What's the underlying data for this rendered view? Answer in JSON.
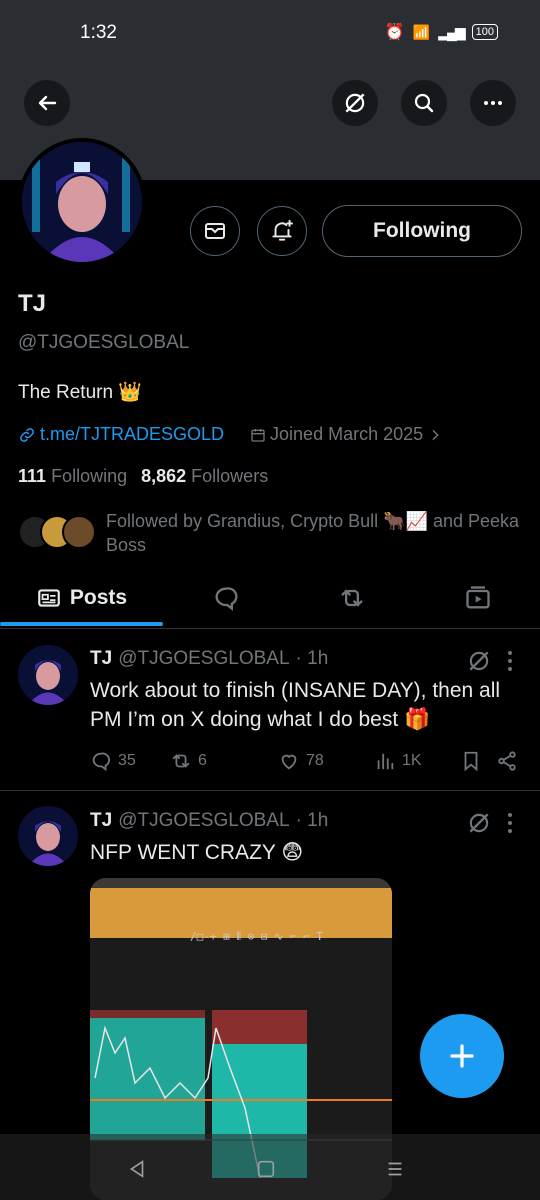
{
  "status_bar": {
    "time": "1:32",
    "battery": "100"
  },
  "profile": {
    "name": "TJ",
    "handle": "@TJGOESGLOBAL",
    "bio": "The Return 👑",
    "link": "t.me/TJTRADESGOLD",
    "joined": "Joined March 2025",
    "following_count": "111",
    "following_label": "Following",
    "followers_count": "8,862",
    "followers_label": "Followers",
    "followed_by": "Followed by Grandius, Crypto Bull 🐂📈 and Peeka Boss",
    "following_button": "Following"
  },
  "tabs": [
    {
      "label": "Posts"
    }
  ],
  "posts": [
    {
      "author": "TJ",
      "handle": "@TJGOESGLOBAL",
      "time": "· 1h",
      "text": "Work about to finish (INSANE DAY),  then all PM I’m on X doing what I do best 🎁",
      "replies": "35",
      "reposts": "6",
      "likes": "78",
      "views": "1K"
    },
    {
      "author": "TJ",
      "handle": "@TJGOESGLOBAL",
      "time": "· 1h",
      "text": "NFP WENT CRAZY 😨"
    }
  ],
  "colors": {
    "accent": "#1d9bf0",
    "background": "#000000",
    "muted": "#71767b"
  },
  "icons": [
    "back-arrow-icon",
    "grok-icon",
    "search-icon",
    "more-icon",
    "mail-icon",
    "notify-bell-icon",
    "link-icon",
    "calendar-icon",
    "chevron-right-icon",
    "reply-icon",
    "repost-icon",
    "like-icon",
    "views-icon",
    "bookmark-icon",
    "share-icon",
    "compose-icon"
  ]
}
